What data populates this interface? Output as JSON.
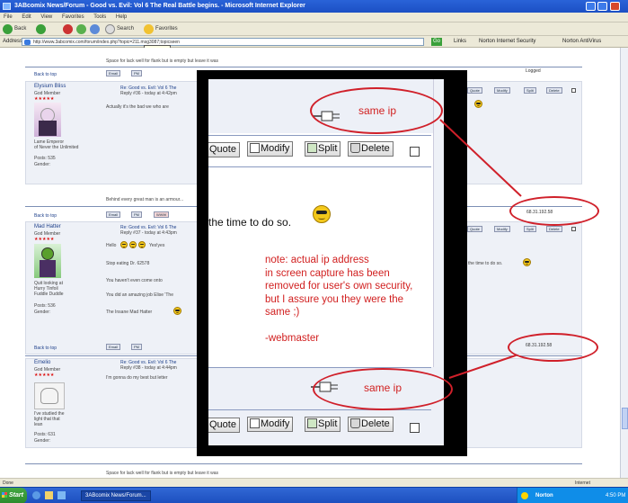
{
  "window": {
    "title": "3ABcomix News/Forum - Good vs. Evil: Vol 6 The Real Battle begins. - Microsoft Internet Explorer"
  },
  "menu": [
    "File",
    "Edit",
    "View",
    "Favorites",
    "Tools",
    "Help"
  ],
  "toolbar": {
    "back": "Back",
    "search": "Search",
    "favorites": "Favorites"
  },
  "address": {
    "label": "Address",
    "url": "http://www.3abcomix.com/forum/index.php?topic=211.msg3087;topicseen",
    "go": "Go",
    "links": "Links",
    "norton": "Norton Internet Security",
    "norton_antivirus": "Norton AntiVirus"
  },
  "tooltip": "Favorites",
  "forum": {
    "top_line": "Space for lack well for flank but is empty but leave it was",
    "back_to_top": "Back to top",
    "post1": {
      "user": "Elysium Bliss",
      "rank": "God Member",
      "title": "Re: Good vs. Evil: Vol 6 The",
      "reply": "Reply #36 - today at 4:42pm",
      "body": "Actually it's the bad we who are",
      "custom": "Lame Emperor",
      "custom2": "of Never the Unlimited",
      "posts": "Posts: 535",
      "gender": "Gender:"
    },
    "mid_line": "Behind every great man is an armour...",
    "post2": {
      "user": "Mad Hatter",
      "rank": "God Member",
      "title": "Re: Good vs. Evil: Vol 6 The",
      "reply": "Reply #37 - today at 4:43pm",
      "line1": "Hello",
      "line1b": "Yes!yes",
      "line2": "Stop eating Dr. 62578",
      "line3": "You haven't even come onto",
      "line4": "You did an amazing job Elise 'The",
      "line5": "The Insane Mad Hatter",
      "custom": "Quit looking at",
      "custom2": "Hurry Tinfoil",
      "custom3": "Fuddle Duddle",
      "posts": "Posts: 536",
      "gender": "Gender:",
      "right_text": "the time to do so."
    },
    "post3": {
      "user": "Emelio",
      "rank": "God Member",
      "title": "Re: Good vs. Evil: Vol 6 The",
      "reply": "Reply #38 - today at 4:44pm",
      "body": "I'm gonna do my best but letter",
      "custom": "I've studied the",
      "custom2": "light that that",
      "custom3": "lean",
      "posts": "Posts: 631",
      "gender": "Gender:"
    },
    "bottom_line": "Space for lack well for flank but is empty but leave it was",
    "ip_short": "Logged",
    "ip1": "68.31.192.58",
    "ip2": "68.31.192.58",
    "buttons": {
      "quote": "Quote",
      "modify": "Modify",
      "split": "Split",
      "delete": "Delete",
      "email": "Email",
      "pm": "PM",
      "www": "WWW"
    }
  },
  "zoom": {
    "quote": "Quote",
    "modify": "Modify",
    "split": "Split",
    "delete": "Delete",
    "body_text": "the time to do so.",
    "note_lines": [
      "note:  actual ip address",
      "in screen capture has been",
      "removed for user's own security,",
      "but I assure you they were the",
      "same ;)"
    ],
    "signature": "-webmaster",
    "label_top": "same ip",
    "label_bottom": "same ip"
  },
  "status": {
    "text": "Done",
    "zone": "Internet"
  },
  "taskbar": {
    "start": "Start",
    "window": "3ABcomix News/Forum...",
    "norton": "Norton",
    "clock": "4:50 PM"
  },
  "colors": {
    "annotation": "#d0202a",
    "note_text": "#d11f1f",
    "forum_rule": "#7d8fb5"
  }
}
